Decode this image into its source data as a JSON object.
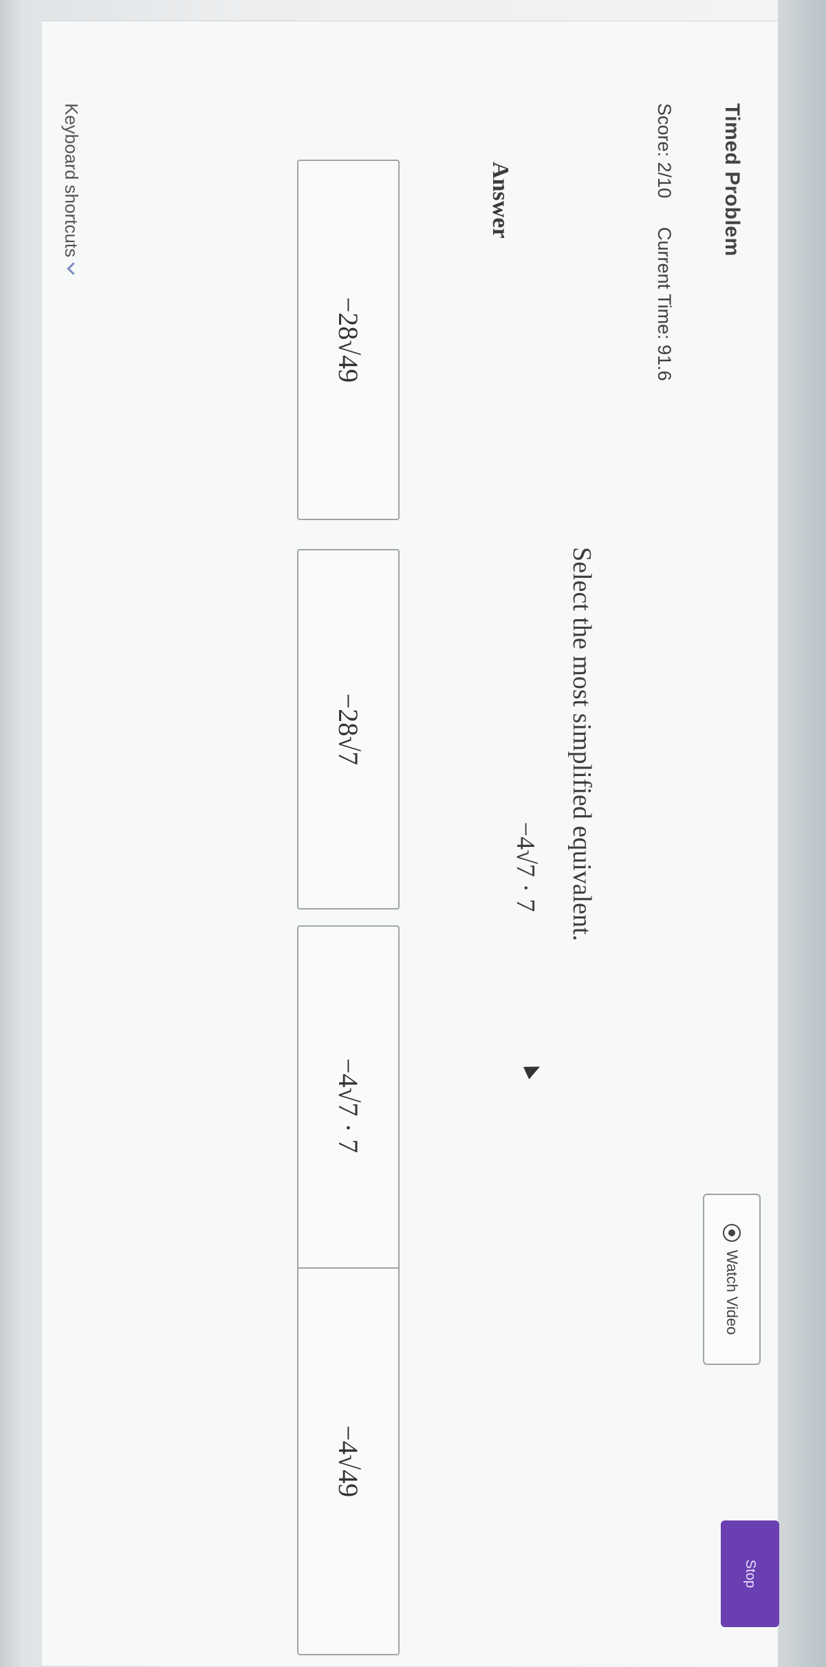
{
  "header": {
    "title": "Timed Problem",
    "score": "Score: 2/10",
    "current_time": "Current Time: 91.6",
    "watch_video_label": "Watch Video",
    "stop_label": "Stop"
  },
  "problem": {
    "prompt": "Select the most simplified equivalent.",
    "expression": "−4√7 · 7"
  },
  "answer": {
    "label": "Answer",
    "options": [
      "−28√49",
      "−28√7",
      "−4√7 · 7",
      "−4√49"
    ]
  },
  "footer": {
    "keyboard_shortcuts": "Keyboard shortcuts"
  },
  "colors": {
    "stop_button": "#6a3fb1"
  }
}
